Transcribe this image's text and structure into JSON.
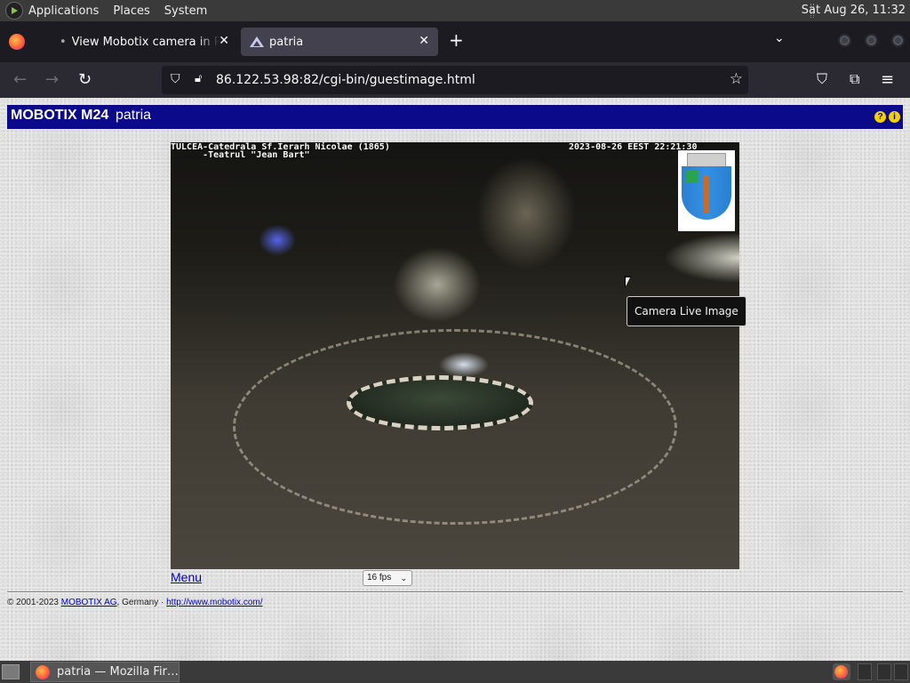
{
  "top_panel": {
    "menu": [
      "Applications",
      "Places",
      "System"
    ],
    "clock": "Sat Aug 26, 11:32"
  },
  "browser": {
    "tabs": [
      {
        "title": "View Mobotix camera in Romania",
        "active": false
      },
      {
        "title": "patria",
        "active": true
      }
    ],
    "url": "86.122.53.98:82/cgi-bin/guestimage.html"
  },
  "page": {
    "brand": "MOBOTIX M24",
    "camera_name": "patria",
    "overlay_line1": "TULCEA-Catedrala Sf.Ierarh Nicolae (1865)",
    "overlay_line2": "      -Teatrul \"Jean Bart\"",
    "overlay_timestamp": "2023-08-26 EEST 22:21:30",
    "tooltip": "Camera Live Image",
    "menu_link": "Menu",
    "fps": "16 fps",
    "footer_copyright": "© 2001-2023 ",
    "footer_company": "MOBOTIX AG",
    "footer_country": ", Germany · ",
    "footer_url": "http://www.mobotix.com/"
  },
  "taskbar": {
    "window_title": "patria — Mozilla Fir…"
  },
  "colors": {
    "title_bar": "#0a0a8a",
    "link": "#0000cc",
    "help_icon": "#f5d000"
  }
}
